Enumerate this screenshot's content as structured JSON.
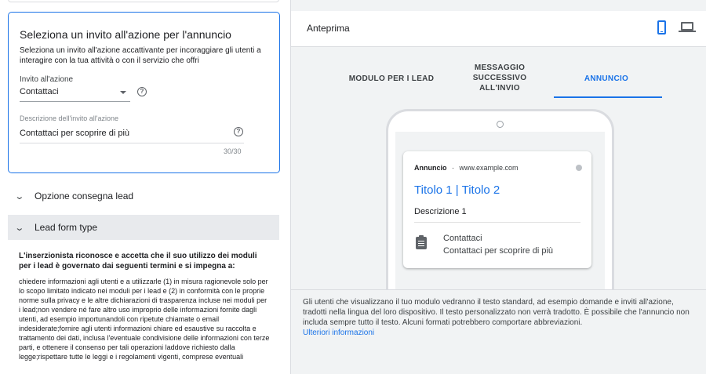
{
  "cta_card": {
    "title": "Seleziona un invito all'azione per l'annuncio",
    "description": "Seleziona un invito all'azione accattivante per incoraggiare gli utenti a interagire con la tua attività o con il servizio che offri",
    "cta_label": "Invito all'azione",
    "cta_value": "Contattaci",
    "desc_label": "Descrizione dell'invito all'azione",
    "desc_value": "Contattaci per scoprire di più",
    "desc_counter": "30/30",
    "help_glyph": "?"
  },
  "sections": {
    "lead_delivery": "Opzione consegna lead",
    "lead_form_type": "Lead form type",
    "chevron": "⌄"
  },
  "terms": {
    "heading": "L'inserzionista riconosce e accetta che il suo utilizzo dei moduli per i lead è governato dai seguenti termini e si impegna a:",
    "body": "chiedere informazioni agli utenti e a utilizzarle (1) in misura ragionevole solo per lo scopo limitato indicato nei moduli per i lead e (2) in conformità con le proprie norme sulla privacy e le altre dichiarazioni di trasparenza incluse nei moduli per i lead;non vendere né fare altro uso improprio delle informazioni fornite dagli utenti, ad esempio importunandoli con ripetute chiamate o email indesiderate;fornire agli utenti informazioni chiare ed esaustive su raccolta e trattamento dei dati, inclusa l'eventuale condivisione delle informazioni con terze parti, e ottenere il consenso per tali operazioni laddove richiesto dalla legge;rispettare tutte le leggi e i regolamenti vigenti, comprese eventuali"
  },
  "preview": {
    "title": "Anteprima",
    "device_mobile_icon": "phone-icon",
    "device_desktop_icon": "laptop-icon",
    "tabs": [
      {
        "label": "MODULO PER I LEAD"
      },
      {
        "label": "MESSAGGIO SUCCESSIVO ALL'INVIO"
      },
      {
        "label": "ANNUNCIO"
      }
    ],
    "active_tab": 2
  },
  "ad": {
    "badge": "Annuncio",
    "separator": "·",
    "domain": "www.example.com",
    "headline": "Titolo 1 | Titolo 2",
    "description": "Descrizione 1",
    "cta": "Contattaci",
    "cta_description": "Contattaci per scoprire di più"
  },
  "notice": {
    "text": "Gli utenti che visualizzano il tuo modulo vedranno il testo standard, ad esempio domande e inviti all'azione, tradotti nella lingua del loro dispositivo. Il testo personalizzato non verrà tradotto. È possibile che l'annuncio non includa sempre tutto il testo. Alcuni formati potrebbero comportare abbreviazioni.",
    "link": "Ulteriori informazioni"
  },
  "colors": {
    "accent": "#1a73e8",
    "panel_bg": "#f1f3f4",
    "selected_row": "#e8eaed"
  }
}
